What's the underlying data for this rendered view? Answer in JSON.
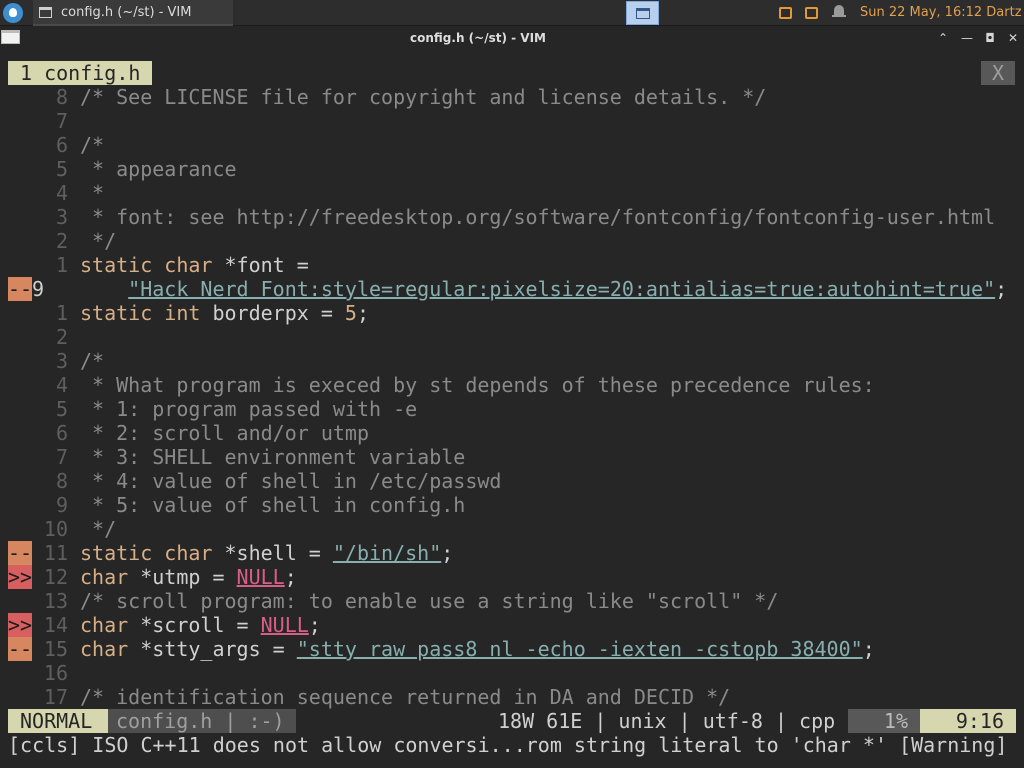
{
  "panel": {
    "task_title": "config.h (~/st) - VIM",
    "clock": "Sun 22 May, 16:12  Dartz"
  },
  "window": {
    "title": "config.h (~/st) - VIM",
    "buttons": {
      "minimize": "⌃",
      "restore": "—",
      "maximize": "◘",
      "close": "✕"
    }
  },
  "tabline": {
    "tab": "1 config.h",
    "close": "X"
  },
  "colors": {
    "accent": "#d7d7af",
    "sign_modified": "#d7875f",
    "sign_error": "#d75f5f",
    "string": "#87afaf",
    "keyword": "#d7af87",
    "comment": "#8a8a8a"
  },
  "editor": {
    "lines": [
      {
        "sign": "",
        "num": "8",
        "segs": [
          {
            "t": "/* See LICENSE file for copyright and license details. */",
            "c": "cm"
          }
        ]
      },
      {
        "sign": "",
        "num": "7",
        "segs": []
      },
      {
        "sign": "",
        "num": "6",
        "segs": [
          {
            "t": "/*",
            "c": "cm"
          }
        ]
      },
      {
        "sign": "",
        "num": "5",
        "segs": [
          {
            "t": " * appearance",
            "c": "cm"
          }
        ]
      },
      {
        "sign": "",
        "num": "4",
        "segs": [
          {
            "t": " *",
            "c": "cm"
          }
        ]
      },
      {
        "sign": "",
        "num": "3",
        "segs": [
          {
            "t": " * font: see http://freedesktop.org/software/fontconfig/fontconfig-user.html",
            "c": "cm"
          }
        ]
      },
      {
        "sign": "",
        "num": "2",
        "segs": [
          {
            "t": " */",
            "c": "cm"
          }
        ]
      },
      {
        "sign": "",
        "num": "1",
        "segs": [
          {
            "t": "static",
            "c": "kw"
          },
          {
            "t": " "
          },
          {
            "t": "char",
            "c": "kw"
          },
          {
            "t": " *font ="
          }
        ]
      },
      {
        "sign": "--",
        "signtype": "mod",
        "num": "9",
        "current": true,
        "segs": [
          {
            "t": "    "
          },
          {
            "t": "\"Hack Nerd Font:style=regular:pixelsize=20:antialias=true:autohint=true\"",
            "c": "str"
          },
          {
            "t": ";"
          }
        ]
      },
      {
        "sign": "",
        "num": "1",
        "segs": [
          {
            "t": "static",
            "c": "kw"
          },
          {
            "t": " "
          },
          {
            "t": "int",
            "c": "kw"
          },
          {
            "t": " borderpx = "
          },
          {
            "t": "5",
            "c": "numv"
          },
          {
            "t": ";"
          }
        ]
      },
      {
        "sign": "",
        "num": "2",
        "segs": []
      },
      {
        "sign": "",
        "num": "3",
        "segs": [
          {
            "t": "/*",
            "c": "cm"
          }
        ]
      },
      {
        "sign": "",
        "num": "4",
        "segs": [
          {
            "t": " * What program is execed by st depends of these precedence rules:",
            "c": "cm"
          }
        ]
      },
      {
        "sign": "",
        "num": "5",
        "segs": [
          {
            "t": " * 1: program passed with -e",
            "c": "cm"
          }
        ]
      },
      {
        "sign": "",
        "num": "6",
        "segs": [
          {
            "t": " * 2: scroll and/or utmp",
            "c": "cm"
          }
        ]
      },
      {
        "sign": "",
        "num": "7",
        "segs": [
          {
            "t": " * 3: SHELL environment variable",
            "c": "cm"
          }
        ]
      },
      {
        "sign": "",
        "num": "8",
        "segs": [
          {
            "t": " * 4: value of shell in /etc/passwd",
            "c": "cm"
          }
        ]
      },
      {
        "sign": "",
        "num": "9",
        "segs": [
          {
            "t": " * 5: value of shell in config.h",
            "c": "cm"
          }
        ]
      },
      {
        "sign": "",
        "num": "10",
        "segs": [
          {
            "t": " */",
            "c": "cm"
          }
        ]
      },
      {
        "sign": "--",
        "signtype": "mod",
        "num": "11",
        "segs": [
          {
            "t": "static",
            "c": "kw"
          },
          {
            "t": " "
          },
          {
            "t": "char",
            "c": "kw"
          },
          {
            "t": " *shell = "
          },
          {
            "t": "\"/bin/sh\"",
            "c": "str"
          },
          {
            "t": ";"
          }
        ]
      },
      {
        "sign": ">>",
        "signtype": "err",
        "num": "12",
        "segs": [
          {
            "t": "char",
            "c": "kw"
          },
          {
            "t": " *utmp = "
          },
          {
            "t": "NULL",
            "c": "nul"
          },
          {
            "t": ";"
          }
        ]
      },
      {
        "sign": "",
        "num": "13",
        "segs": [
          {
            "t": "/* scroll program: to enable use a string like \"scroll\" */",
            "c": "cm"
          }
        ]
      },
      {
        "sign": ">>",
        "signtype": "err",
        "num": "14",
        "segs": [
          {
            "t": "char",
            "c": "kw"
          },
          {
            "t": " *scroll = "
          },
          {
            "t": "NULL",
            "c": "nul"
          },
          {
            "t": ";"
          }
        ]
      },
      {
        "sign": "--",
        "signtype": "mod",
        "num": "15",
        "segs": [
          {
            "t": "char",
            "c": "kw"
          },
          {
            "t": " *stty_args = "
          },
          {
            "t": "\"stty raw pass8 nl -echo -iexten -cstopb 38400\"",
            "c": "str"
          },
          {
            "t": ";"
          }
        ]
      },
      {
        "sign": "",
        "num": "16",
        "segs": []
      },
      {
        "sign": "",
        "num": "17",
        "segs": [
          {
            "t": "/* identification sequence returned in DA and DECID */",
            "c": "cm"
          }
        ]
      }
    ]
  },
  "statusline": {
    "mode": "NORMAL",
    "file": "config.h | :-)",
    "info": "18W 61E | unix | utf-8 | cpp",
    "percent": "1%",
    "position": "9:16"
  },
  "message": "[ccls] ISO C++11 does not allow conversi...rom string literal to 'char *' [Warning]"
}
